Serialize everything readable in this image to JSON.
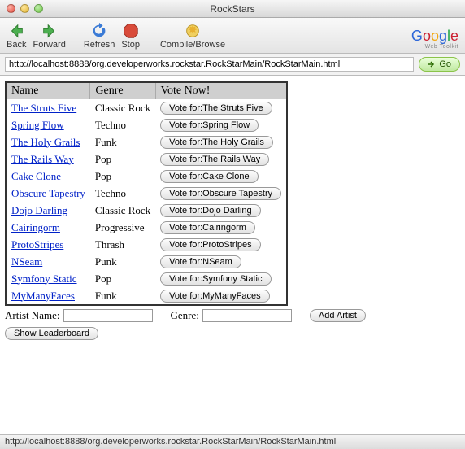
{
  "window": {
    "title": "RockStars"
  },
  "toolbar": {
    "back": "Back",
    "forward": "Forward",
    "refresh": "Refresh",
    "stop": "Stop",
    "compile": "Compile/Browse",
    "brand_sub": "Web Toolkit"
  },
  "address": {
    "url": "http://localhost:8888/org.developerworks.rockstar.RockStarMain/RockStarMain.html",
    "go": "Go"
  },
  "table": {
    "headers": {
      "name": "Name",
      "genre": "Genre",
      "vote": "Vote Now!"
    },
    "rows": [
      {
        "name": "The Struts Five",
        "genre": "Classic Rock",
        "vote": "Vote for:The Struts Five"
      },
      {
        "name": "Spring Flow",
        "genre": "Techno",
        "vote": "Vote for:Spring Flow"
      },
      {
        "name": "The Holy Grails",
        "genre": "Funk",
        "vote": "Vote for:The Holy Grails"
      },
      {
        "name": "The Rails Way",
        "genre": "Pop",
        "vote": "Vote for:The Rails Way"
      },
      {
        "name": "Cake Clone",
        "genre": "Pop",
        "vote": "Vote for:Cake Clone"
      },
      {
        "name": "Obscure Tapestry",
        "genre": "Techno",
        "vote": "Vote for:Obscure Tapestry"
      },
      {
        "name": "Dojo Darling",
        "genre": "Classic Rock",
        "vote": "Vote for:Dojo Darling"
      },
      {
        "name": "Cairingorm",
        "genre": "Progressive",
        "vote": "Vote for:Cairingorm"
      },
      {
        "name": "ProtoStripes",
        "genre": "Thrash",
        "vote": "Vote for:ProtoStripes"
      },
      {
        "name": "NSeam",
        "genre": "Punk",
        "vote": "Vote for:NSeam"
      },
      {
        "name": "Symfony Static",
        "genre": "Pop",
        "vote": "Vote for:Symfony Static"
      },
      {
        "name": "MyManyFaces",
        "genre": "Funk",
        "vote": "Vote for:MyManyFaces"
      }
    ]
  },
  "form": {
    "artist_label": "Artist Name:",
    "genre_label": "Genre:",
    "add_button": "Add Artist",
    "show_button": "Show Leaderboard"
  },
  "status": {
    "text": "http://localhost:8888/org.developerworks.rockstar.RockStarMain/RockStarMain.html"
  }
}
